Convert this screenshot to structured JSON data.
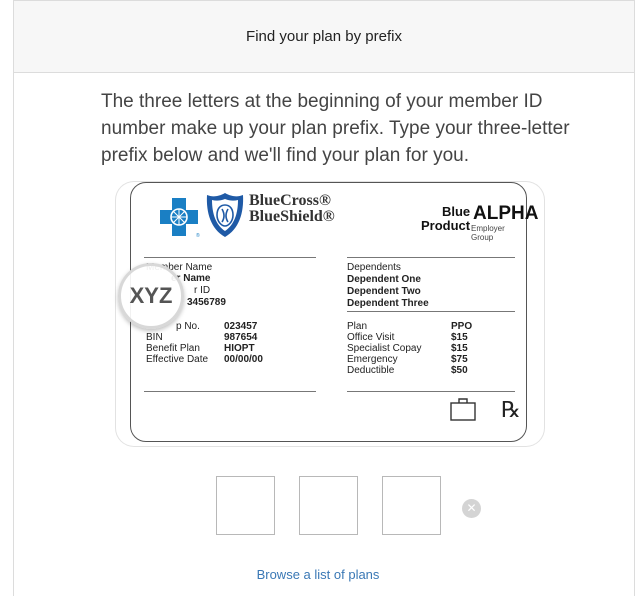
{
  "header": {
    "title": "Find your plan by prefix"
  },
  "description": "The three letters at the beginning of your member ID number make up your plan prefix. Type your three-letter prefix below and we'll find your plan for you.",
  "card": {
    "brand_line1": "BlueCross®",
    "brand_line2": "BlueShield®",
    "product_line1": "Blue",
    "product_line2": "Product",
    "alpha": "ALPHA",
    "employer": "Employer Group",
    "member_name_label": "Member Name",
    "member_name_value": "er Name",
    "member_id_label": "r ID",
    "member_id_value": "3456789",
    "magnified_prefix": "XYZ",
    "fields_left": [
      {
        "label": "p No.",
        "value": "023457"
      },
      {
        "label": "BIN",
        "value": "987654"
      },
      {
        "label": "Benefit Plan",
        "value": "HIOPT"
      },
      {
        "label": "Effective Date",
        "value": "00/00/00"
      }
    ],
    "dependents_label": "Dependents",
    "dependents": [
      "Dependent One",
      "Dependent Two",
      "Dependent Three"
    ],
    "fields_right": [
      {
        "label": "Plan",
        "value": "PPO"
      },
      {
        "label": "Office Visit",
        "value": "$15"
      },
      {
        "label": "Specialist Copay",
        "value": "$15"
      },
      {
        "label": "Emergency",
        "value": "$75"
      },
      {
        "label": "Deductible",
        "value": "$50"
      }
    ],
    "rx": "℞"
  },
  "prefix_inputs": [
    "",
    "",
    ""
  ],
  "clear_icon": "x-circle-icon",
  "browse_link": "Browse a list of plans",
  "colors": {
    "link": "#3a78b5",
    "brand_blue": "#1a7fc4",
    "shield_blue": "#1f5aa6"
  }
}
